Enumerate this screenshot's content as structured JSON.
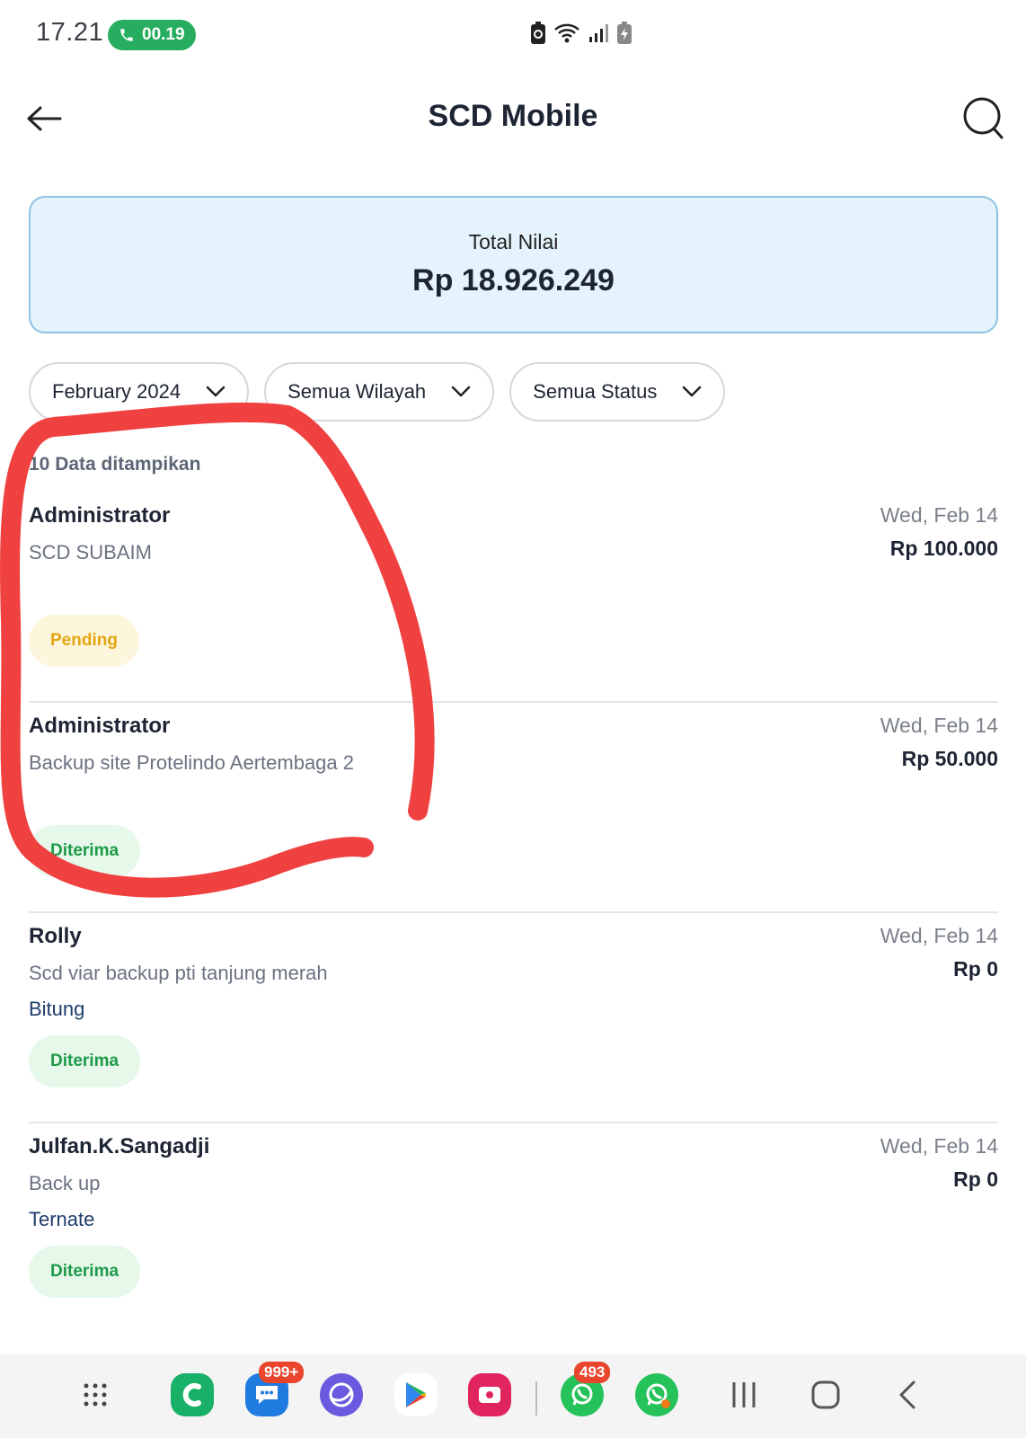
{
  "status_bar": {
    "time": "17.21",
    "call_timer": "00.19",
    "icons": [
      "battery-saver-icon",
      "wifi-icon",
      "signal-icon",
      "battery-charging-icon"
    ]
  },
  "app_bar": {
    "title": "SCD Mobile",
    "back_icon": "arrow-left-icon",
    "search_icon": "search-icon"
  },
  "summary": {
    "label": "Total Nilai",
    "value": "Rp 18.926.249"
  },
  "filters": [
    {
      "label": "February 2024"
    },
    {
      "label": "Semua Wilayah"
    },
    {
      "label": "Semua Status"
    }
  ],
  "count_label": "10 Data ditampikan",
  "items": [
    {
      "name": "Administrator",
      "description": "SCD SUBAIM",
      "region": "",
      "date": "Wed, Feb 14",
      "amount": "Rp 100.000",
      "status": "Pending",
      "status_type": "pending"
    },
    {
      "name": "Administrator",
      "description": "Backup site Protelindo Aertembaga 2",
      "region": "",
      "date": "Wed, Feb 14",
      "amount": "Rp 50.000",
      "status": "Diterima",
      "status_type": "accepted"
    },
    {
      "name": "Rolly",
      "description": "Scd viar backup pti tanjung merah",
      "region": "Bitung",
      "date": "Wed, Feb 14",
      "amount": "Rp 0",
      "status": "Diterima",
      "status_type": "accepted"
    },
    {
      "name": "Julfan.K.Sangadji",
      "description": "Back up",
      "region": "Ternate",
      "date": "Wed, Feb 14",
      "amount": "Rp 0",
      "status": "Diterima",
      "status_type": "accepted"
    }
  ],
  "nav_bar": {
    "apps": [
      {
        "name": "app-drawer-icon"
      },
      {
        "name": "call-app-icon"
      },
      {
        "name": "messages-icon",
        "badge": "999+"
      },
      {
        "name": "internet-browser-icon"
      },
      {
        "name": "play-store-icon"
      },
      {
        "name": "screen-recorder-icon"
      },
      {
        "name": "whatsapp-icon",
        "badge": "493"
      },
      {
        "name": "whatsapp-business-icon"
      }
    ],
    "buttons": [
      "recents-button",
      "home-button",
      "back-button"
    ]
  },
  "colors": {
    "accent_blue_border": "#8ec3e3",
    "card_bg": "#e4f3fc",
    "pending": "#e3a711",
    "accepted": "#1f9a49",
    "annotation": "#f04141"
  }
}
